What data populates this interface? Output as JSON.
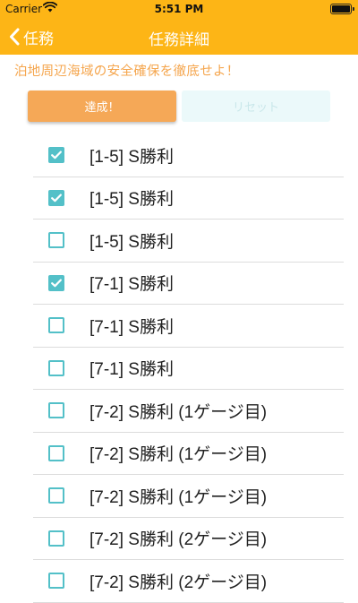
{
  "status_bar": {
    "carrier": "Carrier",
    "time": "5:51 PM"
  },
  "nav": {
    "back_label": "任務",
    "title": "任務詳細"
  },
  "mission": {
    "description": "泊地周辺海域の安全確保を徹底せよ！",
    "achieve_label": "達成！",
    "reset_label": "リセット"
  },
  "tasks": [
    {
      "label": "[1-5] S勝利",
      "checked": true
    },
    {
      "label": "[1-5] S勝利",
      "checked": true
    },
    {
      "label": "[1-5] S勝利",
      "checked": false
    },
    {
      "label": "[7-1] S勝利",
      "checked": true
    },
    {
      "label": "[7-1] S勝利",
      "checked": false
    },
    {
      "label": "[7-1] S勝利",
      "checked": false
    },
    {
      "label": "[7-2] S勝利 (1ゲージ目)",
      "checked": false
    },
    {
      "label": "[7-2] S勝利 (1ゲージ目)",
      "checked": false
    },
    {
      "label": "[7-2] S勝利 (1ゲージ目)",
      "checked": false
    },
    {
      "label": "[7-2] S勝利 (2ゲージ目)",
      "checked": false
    },
    {
      "label": "[7-2] S勝利 (2ゲージ目)",
      "checked": false
    }
  ],
  "colors": {
    "header": "#FDB516",
    "accent_teal": "#53C0C8",
    "achieve_button": "#F5A857",
    "description_text": "#F5A64E"
  }
}
